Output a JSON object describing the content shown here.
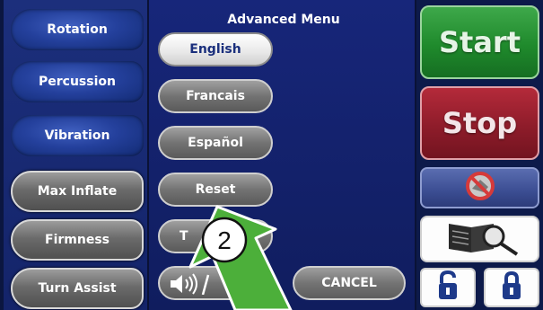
{
  "left_menu": {
    "items": [
      {
        "label": "Rotation",
        "style": "blue"
      },
      {
        "label": "Percussion",
        "style": "blue"
      },
      {
        "label": "Vibration",
        "style": "blue"
      },
      {
        "label": "Max Inflate",
        "style": "gray"
      },
      {
        "label": "Firmness",
        "style": "gray"
      },
      {
        "label": "Turn Assist",
        "style": "gray"
      }
    ]
  },
  "advanced_menu": {
    "title": "Advanced Menu",
    "language_buttons": [
      {
        "label": "English",
        "selected": true
      },
      {
        "label": "Francais",
        "selected": false
      },
      {
        "label": "Español",
        "selected": false
      }
    ],
    "reset_label": "Reset",
    "partial_button_label": "T",
    "cancel_label": "CANCEL"
  },
  "right_panel": {
    "start_label": "Start",
    "stop_label": "Stop",
    "icons": [
      "mute-alarm-icon",
      "manual-search-icon",
      "unlock-icon",
      "lock-icon"
    ]
  },
  "callout": {
    "number": "2"
  },
  "colors": {
    "start": "#1f8a2c",
    "stop": "#8e1c2a",
    "pointer": "#4caf3a"
  }
}
